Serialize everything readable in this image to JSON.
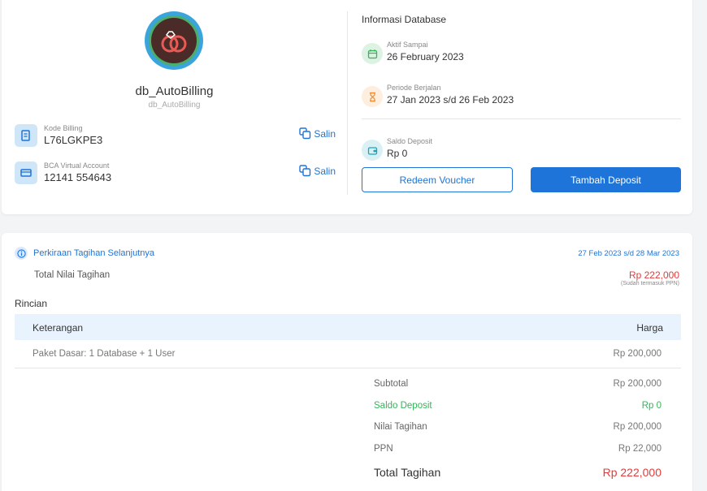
{
  "profile": {
    "db_name": "db_AutoBilling",
    "db_subname": "db_AutoBilling",
    "billing_code_label": "Kode Billing",
    "billing_code_value": "L76LGKPE3",
    "va_label": "BCA Virtual Account",
    "va_value": "12141 554643",
    "copy_label": "Salin"
  },
  "database_info": {
    "title": "Informasi Database",
    "active_until_label": "Aktif Sampai",
    "active_until_value": "26 February 2023",
    "period_label": "Periode Berjalan",
    "period_value": "27 Jan 2023 s/d 26 Feb 2023",
    "deposit_label": "Saldo Deposit",
    "deposit_value": "Rp 0",
    "redeem_button": "Redeem Voucher",
    "add_deposit_button": "Tambah Deposit"
  },
  "estimate": {
    "title": "Perkiraan Tagihan Selanjutnya",
    "period": "27 Feb 2023 s/d 28 Mar 2023",
    "total_label": "Total Nilai Tagihan",
    "total_value": "Rp 222,000",
    "total_note": "(Sudah termasuk PPN)",
    "rincian_label": "Rincian",
    "table": {
      "col_desc": "Keterangan",
      "col_price": "Harga",
      "rows": [
        {
          "desc": "Paket Dasar: 1 Database + 1 User",
          "price": "Rp 200,000"
        }
      ]
    },
    "summary": {
      "subtotal_label": "Subtotal",
      "subtotal_value": "Rp 200,000",
      "deposit_label": "Saldo Deposit",
      "deposit_value": "Rp 0",
      "bill_label": "Nilai Tagihan",
      "bill_value": "Rp 200,000",
      "ppn_label": "PPN",
      "ppn_value": "Rp 22,000",
      "grand_label": "Total Tagihan",
      "grand_value": "Rp 222,000"
    }
  },
  "colors": {
    "accent": "#1e74d8",
    "danger": "#e23b3b",
    "success": "#35b55a",
    "table_header": "#e8f3fd"
  },
  "icons": [
    "avatar-rings-icon",
    "document-icon",
    "card-icon",
    "copy-icon",
    "calendar-icon",
    "hourglass-icon",
    "wallet-icon",
    "info-icon"
  ]
}
